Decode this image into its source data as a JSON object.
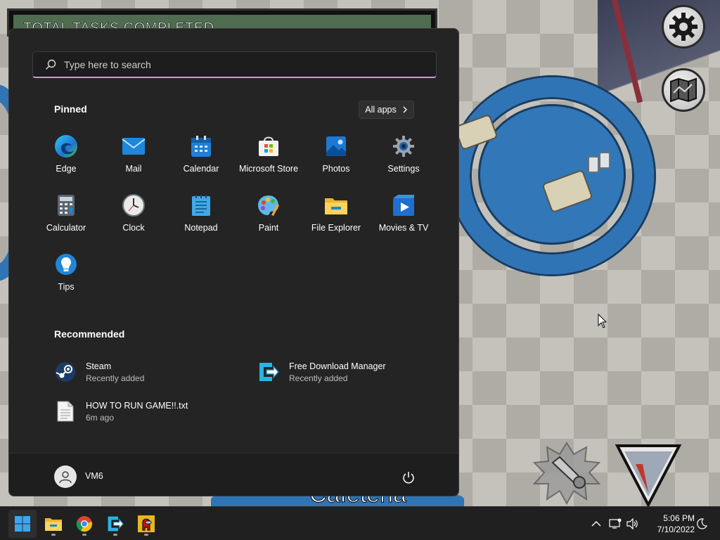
{
  "game": {
    "tasks_label": "TOTAL TASKS COMPLETED",
    "room_name": "Cafeteria",
    "settings_icon": "gear-icon",
    "map_icon": "map-icon",
    "report_icon": "report-megaphone-icon",
    "use_icon": "use-hand-icon"
  },
  "start_menu": {
    "search_placeholder": "Type here to search",
    "pinned_title": "Pinned",
    "all_apps_label": "All apps",
    "pinned": [
      {
        "label": "Edge",
        "icon": "edge-icon"
      },
      {
        "label": "Mail",
        "icon": "mail-icon"
      },
      {
        "label": "Calendar",
        "icon": "calendar-icon"
      },
      {
        "label": "Microsoft Store",
        "icon": "store-icon"
      },
      {
        "label": "Photos",
        "icon": "photos-icon"
      },
      {
        "label": "Settings",
        "icon": "gear-icon"
      },
      {
        "label": "Calculator",
        "icon": "calculator-icon"
      },
      {
        "label": "Clock",
        "icon": "clock-icon"
      },
      {
        "label": "Notepad",
        "icon": "notepad-icon"
      },
      {
        "label": "Paint",
        "icon": "paint-icon"
      },
      {
        "label": "File Explorer",
        "icon": "folder-icon"
      },
      {
        "label": "Movies & TV",
        "icon": "movies-icon"
      },
      {
        "label": "Tips",
        "icon": "tips-icon"
      }
    ],
    "recommended_title": "Recommended",
    "recommended": [
      {
        "name": "Steam",
        "sub": "Recently added",
        "icon": "steam-icon"
      },
      {
        "name": "Free Download Manager",
        "sub": "Recently added",
        "icon": "fdm-icon"
      },
      {
        "name": "HOW TO RUN GAME!!.txt",
        "sub": "6m ago",
        "icon": "text-file-icon"
      }
    ],
    "user_name": "VM6",
    "power_icon": "power-icon"
  },
  "taskbar": {
    "apps": [
      {
        "name": "start",
        "icon": "windows-icon"
      },
      {
        "name": "file-explorer",
        "icon": "folder-icon"
      },
      {
        "name": "chrome",
        "icon": "chrome-icon"
      },
      {
        "name": "free-download-manager",
        "icon": "fdm-icon"
      },
      {
        "name": "among-us",
        "icon": "among-us-icon"
      }
    ],
    "tray": [
      "chevron-up-icon",
      "network-icon",
      "volume-icon",
      "focus-assist-icon"
    ],
    "time": "5:06 PM",
    "date": "7/10/2022"
  },
  "colors": {
    "start_bg": "#242424",
    "taskbar_bg": "#202020",
    "search_accent": "#c79ad9",
    "table_blue": "#2f74b5"
  }
}
